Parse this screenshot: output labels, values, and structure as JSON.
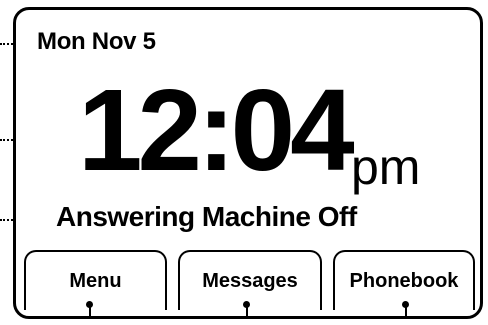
{
  "screen": {
    "date": "Mon Nov 5",
    "time": "12:04",
    "ampm": "pm",
    "status": "Answering Machine Off"
  },
  "softkeys": [
    {
      "label": "Menu"
    },
    {
      "label": "Messages"
    },
    {
      "label": "Phonebook"
    }
  ]
}
